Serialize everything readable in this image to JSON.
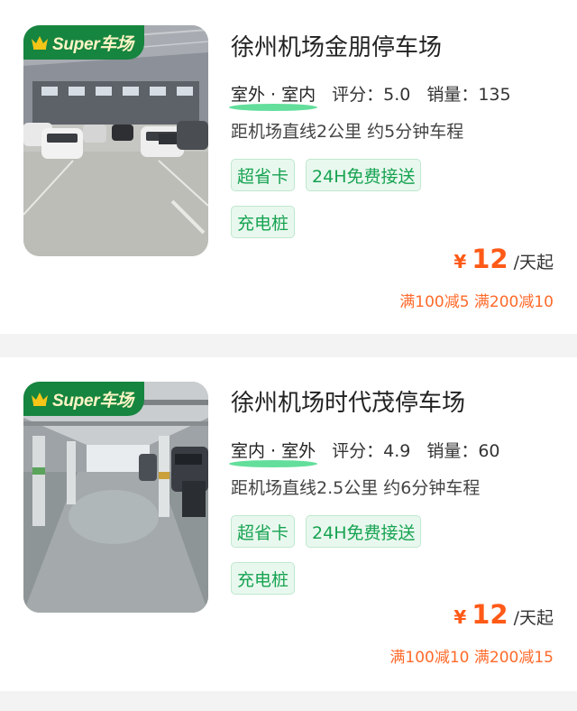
{
  "badge_text": "Super车场",
  "icons": {
    "crown": "crown-icon"
  },
  "colors": {
    "accent_green": "#16853f",
    "tag_green": "#17a352",
    "price_orange": "#ff5a17"
  },
  "lots": [
    {
      "name": "徐州机场金朋停车场",
      "type": "室外 · 室内",
      "score": "评分：5.0",
      "sales": "销量：135",
      "distance": "距机场直线2公里 约5分钟车程",
      "tags": [
        "超省卡",
        "24H免费接送",
        "充电桩"
      ],
      "currency": "¥",
      "price": "12",
      "unit": "/天起",
      "promo": "满100减5 满200减10"
    },
    {
      "name": "徐州机场时代茂停车场",
      "type": "室内 · 室外",
      "score": "评分：4.9",
      "sales": "销量：60",
      "distance": "距机场直线2.5公里 约6分钟车程",
      "tags": [
        "超省卡",
        "24H免费接送",
        "充电桩"
      ],
      "currency": "¥",
      "price": "12",
      "unit": "/天起",
      "promo": "满100减10 满200减15"
    }
  ]
}
